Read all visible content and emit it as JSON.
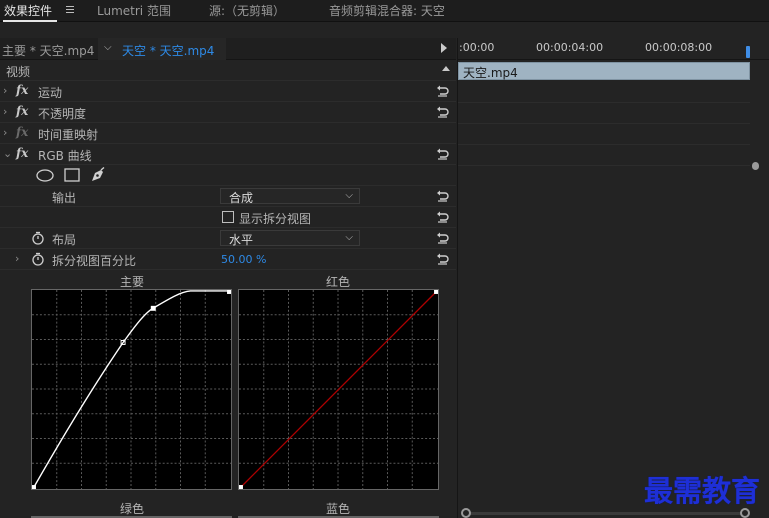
{
  "tabs": [
    {
      "label": "效果控件"
    },
    {
      "label": "Lumetri 范围"
    },
    {
      "label": "源:（无剪辑）"
    },
    {
      "label": "音频剪辑混合器: 天空"
    }
  ],
  "sequence": {
    "source_label": "主要 * 天空.mp4",
    "target_label": "天空 * 天空.mp4"
  },
  "effects": {
    "section_title": "视频",
    "items": [
      {
        "label": "运动"
      },
      {
        "label": "不透明度"
      },
      {
        "label": "时间重映射"
      },
      {
        "label": "RGB 曲线"
      }
    ],
    "rgb_curves": {
      "output_label": "输出",
      "output_value": "合成",
      "split_view_label": "显示拆分视图",
      "layout_label": "布局",
      "layout_value": "水平",
      "split_pct_label": "拆分视图百分比",
      "split_pct_value": "50.00 %"
    },
    "curves": [
      {
        "label": "主要"
      },
      {
        "label": "红色"
      },
      {
        "label": "绿色"
      },
      {
        "label": "蓝色"
      }
    ]
  },
  "timeline": {
    "timecodes": [
      ":00:00",
      "00:00:04:00",
      "00:00:08:00"
    ],
    "clip_label": "天空.mp4"
  },
  "watermark": "最需教育",
  "colors": {
    "accent_blue": "#2e8ae6",
    "red_curve": "#b00000",
    "clip_fill": "#9fb3c2",
    "watermark_blue": "#1e2fd6"
  }
}
